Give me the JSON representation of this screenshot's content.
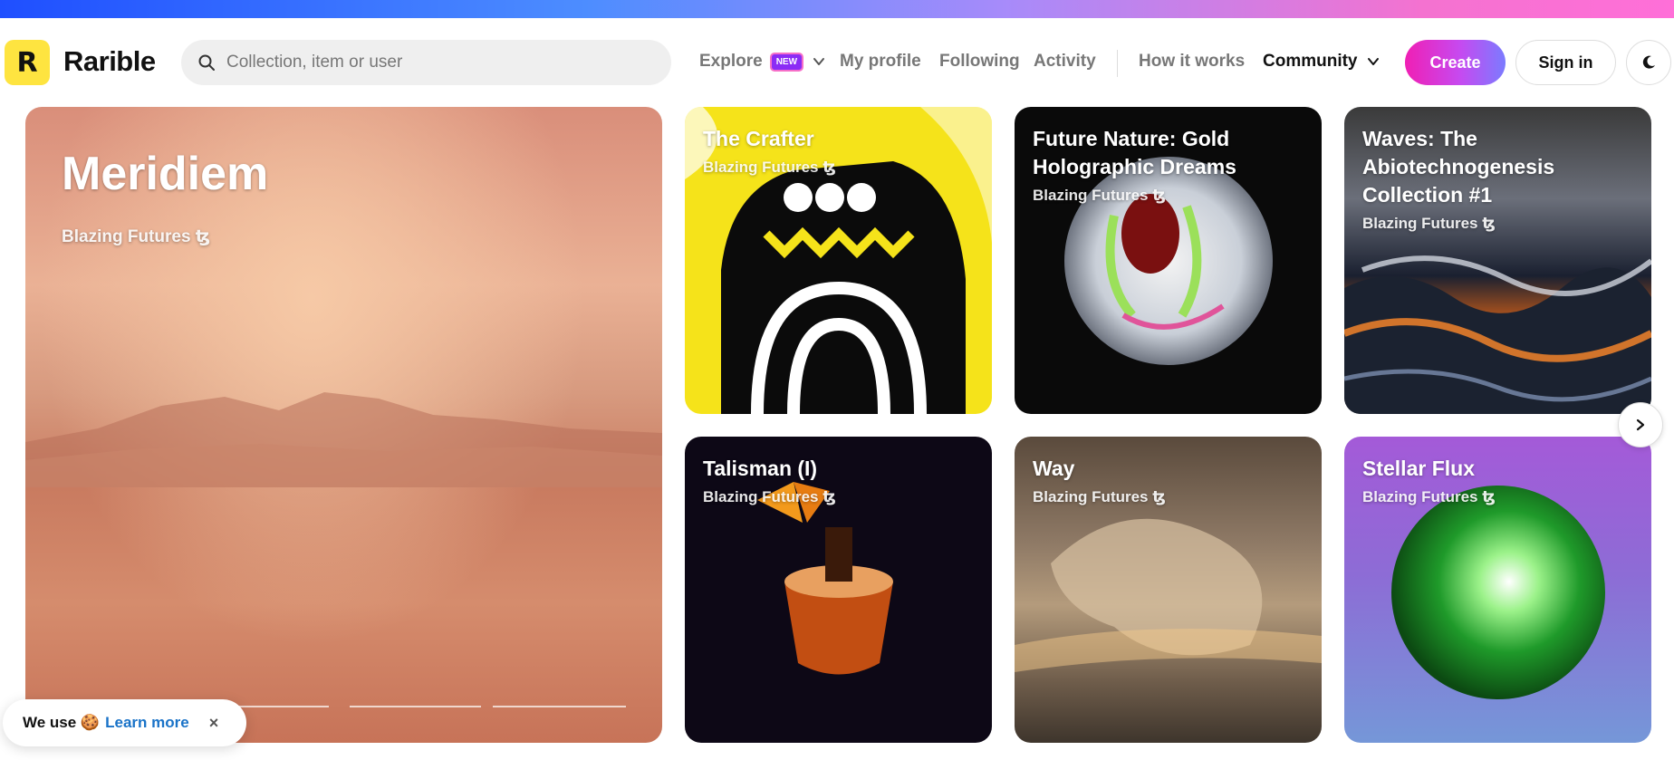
{
  "header": {
    "brand": "Rarible",
    "logo_letter": "R",
    "search_placeholder": "Collection, item or user",
    "nav": {
      "explore": "Explore",
      "explore_badge": "NEW",
      "my_profile": "My profile",
      "following": "Following",
      "activity": "Activity",
      "how_it_works": "How it works",
      "community": "Community"
    },
    "create_label": "Create",
    "signin_label": "Sign in"
  },
  "featured": {
    "title": "Meridiem",
    "creator": "Blazing Futures ꜩ"
  },
  "cards": [
    {
      "title": "The Crafter",
      "creator": "Blazing Futures ꜩ"
    },
    {
      "title": "Future Nature: Gold Holographic Dreams",
      "creator": "Blazing Futures ꜩ"
    },
    {
      "title": "Waves: The Abiotechnogenesis Collection #1",
      "creator": "Blazing Futures ꜩ"
    },
    {
      "title": "Talisman (I)",
      "creator": "Blazing Futures ꜩ"
    },
    {
      "title": "Way",
      "creator": "Blazing Futures ꜩ"
    },
    {
      "title": "Stellar Flux",
      "creator": "Blazing Futures ꜩ"
    }
  ],
  "cookie": {
    "text": "We use 🍪",
    "link": "Learn more",
    "close": "×"
  },
  "colors": {
    "brand_yellow": "#fee440",
    "create_gradient_start": "#f01fb4",
    "create_gradient_end": "#7b7bff",
    "link_blue": "#1a73c8"
  }
}
